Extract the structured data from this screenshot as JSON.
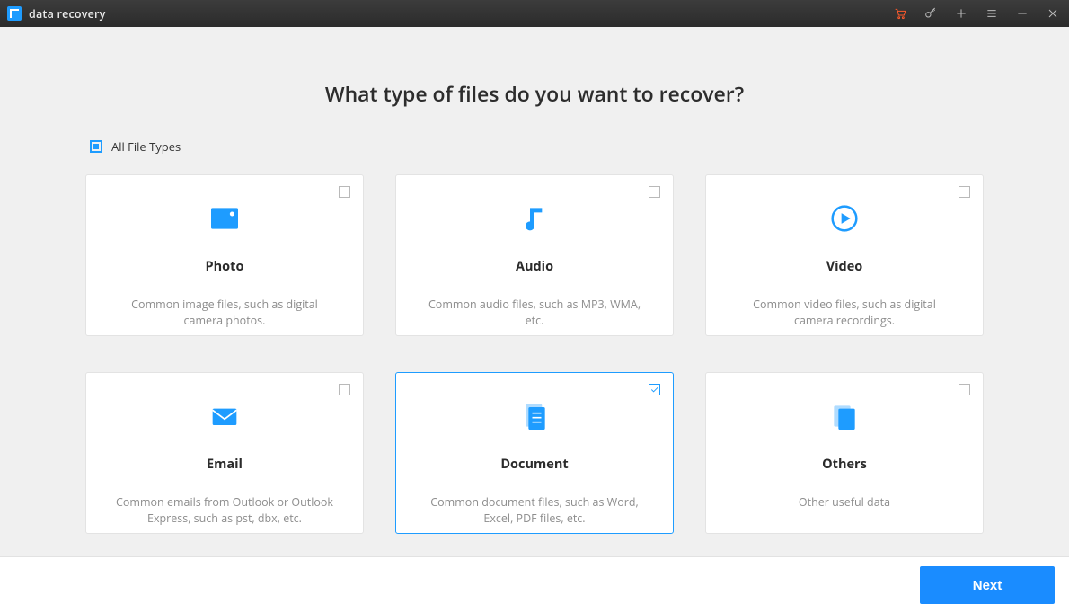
{
  "titlebar": {
    "app_title": "data recovery"
  },
  "heading": "What type of files do you want to recover?",
  "all_files_label": "All File Types",
  "cards": [
    {
      "key": "photo",
      "title": "Photo",
      "desc": "Common image files, such as digital camera photos.",
      "checked": false
    },
    {
      "key": "audio",
      "title": "Audio",
      "desc": "Common audio files, such as MP3, WMA, etc.",
      "checked": false
    },
    {
      "key": "video",
      "title": "Video",
      "desc": "Common video files, such as digital camera recordings.",
      "checked": false
    },
    {
      "key": "email",
      "title": "Email",
      "desc": "Common emails from Outlook or Outlook Express, such as pst, dbx, etc.",
      "checked": false
    },
    {
      "key": "document",
      "title": "Document",
      "desc": "Common document files, such as Word, Excel, PDF files, etc.",
      "checked": true
    },
    {
      "key": "others",
      "title": "Others",
      "desc": "Other useful data",
      "checked": false
    }
  ],
  "footer": {
    "next_label": "Next"
  }
}
